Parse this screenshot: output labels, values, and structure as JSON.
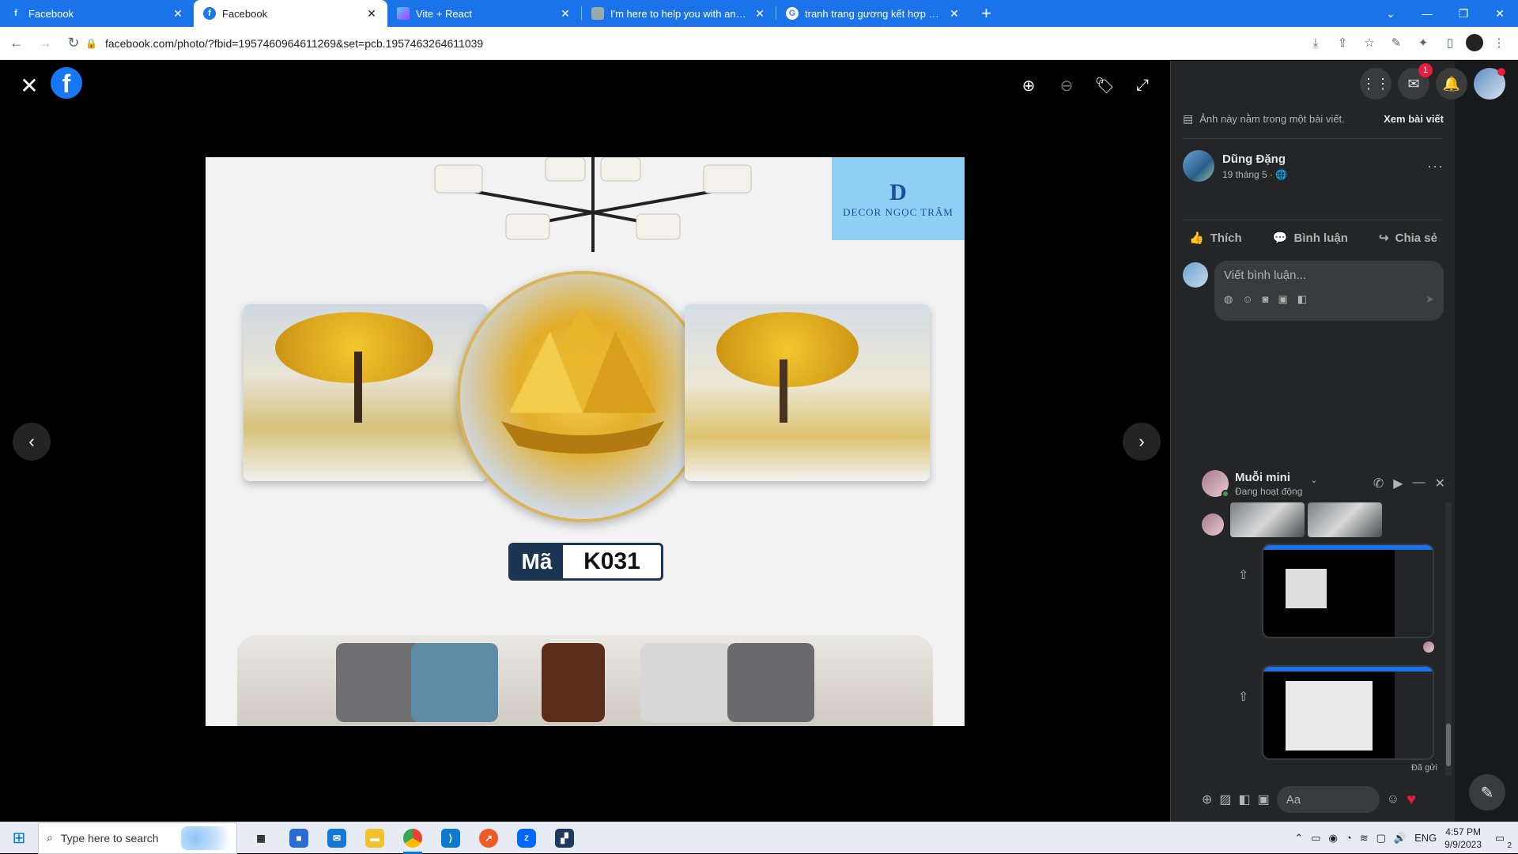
{
  "browser": {
    "tabs": [
      {
        "title": "Facebook",
        "icon": "facebook-icon",
        "active": false
      },
      {
        "title": "Facebook",
        "icon": "facebook-icon",
        "active": true
      },
      {
        "title": "Vite + React",
        "icon": "vite-icon",
        "active": false
      },
      {
        "title": "I'm here to help you with any qu",
        "icon": "chatgpt-icon",
        "active": false
      },
      {
        "title": "tranh trang gương kết hợp với m",
        "icon": "google-icon",
        "active": false
      }
    ],
    "url": "facebook.com/photo/?fbid=1957460964611269&set=pcb.1957463264611039"
  },
  "viewer": {
    "close_icon": "close-icon",
    "logo": "f",
    "photo": {
      "brand_mono": "D",
      "brand_name": "DECOR NGỌC TRÂM",
      "code_prefix": "Mã",
      "code_value": "K031"
    }
  },
  "post": {
    "note_text": "Ảnh này nằm trong một bài viết.",
    "note_link": "Xem bài viết",
    "author": "Dũng Đặng",
    "date": "19 tháng 5 ·",
    "more": "···",
    "actions": {
      "like": "Thích",
      "comment": "Bình luận",
      "share": "Chia sẻ"
    },
    "comment_placeholder": "Viết bình luận..."
  },
  "header_icons": {
    "messenger_badge": "1"
  },
  "chat": {
    "name": "Muỗi mini",
    "status": "Đang hoạt động",
    "sent_label": "Đã gửi",
    "input_placeholder": "Aa"
  },
  "taskbar": {
    "search_placeholder": "Type here to search",
    "language": "ENG",
    "time": "4:57 PM",
    "date": "9/9/2023",
    "notification_count": "2"
  },
  "colors": {
    "chrome_blue": "#1a73e8",
    "fb_blue": "#1877f2",
    "panel_bg": "#242526"
  }
}
